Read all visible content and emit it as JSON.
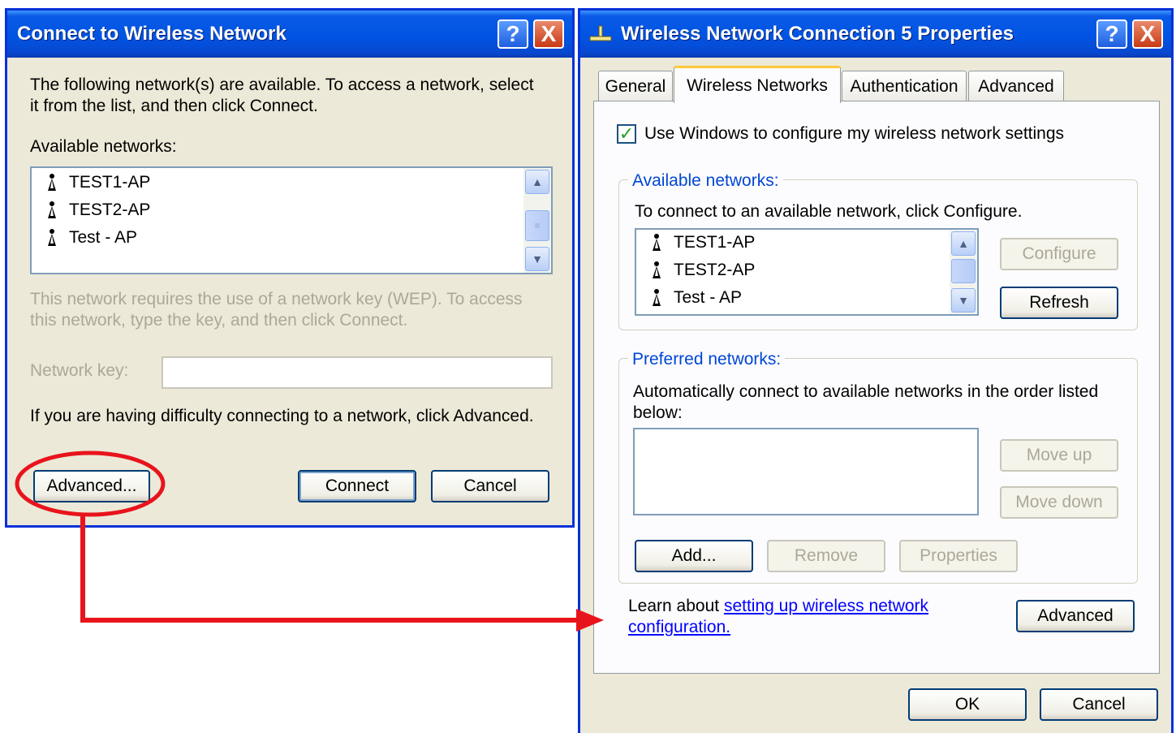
{
  "left_dialog": {
    "title": "Connect to Wireless Network",
    "help_label": "?",
    "close_label": "X",
    "intro_line1": "The following network(s) are available. To access a network, select",
    "intro_line2": "it from the list, and then click Connect.",
    "available_label": "Available networks:",
    "networks": [
      "TEST1-AP",
      "TEST2-AP",
      "Test - AP"
    ],
    "wep_line1": "This network requires the use of a network key (WEP). To access",
    "wep_line2": "this network, type the key, and then click Connect.",
    "network_key_label": "Network key:",
    "network_key_value": "",
    "difficulty_text": "If you are having difficulty connecting to a network, click Advanced.",
    "advanced_button": "Advanced...",
    "connect_button": "Connect",
    "cancel_button": "Cancel"
  },
  "right_dialog": {
    "title": "Wireless Network Connection 5 Properties",
    "help_label": "?",
    "close_label": "X",
    "tabs": [
      {
        "label": "General",
        "active": false
      },
      {
        "label": "Wireless Networks",
        "active": true
      },
      {
        "label": "Authentication",
        "active": false
      },
      {
        "label": "Advanced",
        "active": false
      }
    ],
    "checkbox_checked": true,
    "checkbox_label": "Use Windows to configure my wireless network settings",
    "available_group": "Available networks:",
    "available_desc": "To connect to an available network, click Configure.",
    "networks": [
      "TEST1-AP",
      "TEST2-AP",
      "Test - AP"
    ],
    "configure_button": "Configure",
    "refresh_button": "Refresh",
    "preferred_group": "Preferred networks:",
    "preferred_desc1": "Automatically connect to available networks in the order listed",
    "preferred_desc2": "below:",
    "move_up_button": "Move up",
    "move_down_button": "Move down",
    "add_button": "Add...",
    "remove_button": "Remove",
    "properties_button": "Properties",
    "learn_prefix": "Learn about ",
    "learn_link1": "setting up wireless network",
    "learn_link2": "configuration.",
    "advanced_button": "Advanced",
    "ok_button": "OK",
    "cancel_button": "Cancel"
  },
  "annotation": {
    "highlight_color": "#e8141c",
    "arrow_color": "#e8141c"
  },
  "icons": {
    "network": "wireless-antenna-icon",
    "title": "network-connection-icon",
    "check": "check-mark-icon",
    "scroll_up": "scroll-up-arrow-icon",
    "scroll_down": "scroll-down-arrow-icon"
  }
}
